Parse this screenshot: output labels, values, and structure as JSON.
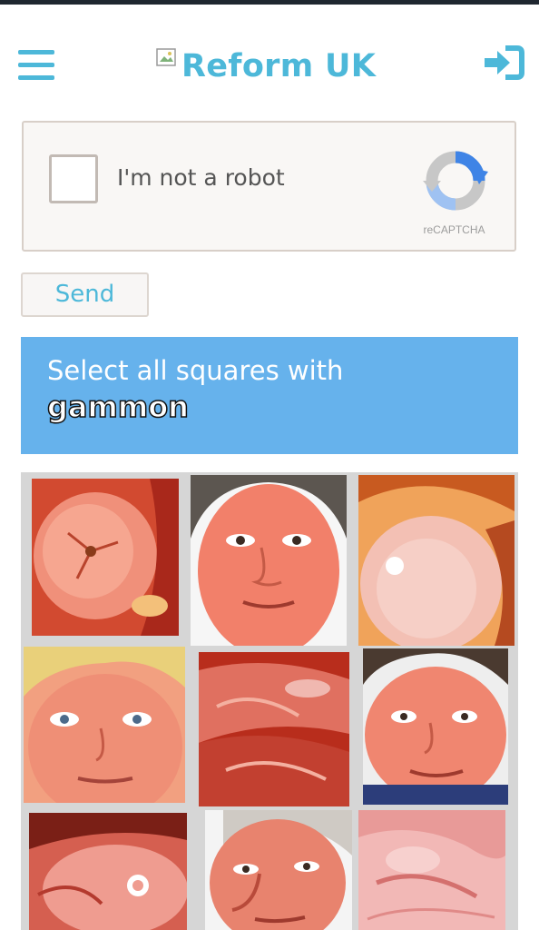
{
  "header": {
    "logo_text": "Reform UK",
    "menu_icon": "hamburger-menu-icon",
    "signin_icon": "sign-in-icon",
    "accent_color": "#4db8d9"
  },
  "recaptcha": {
    "checkbox_label": "I'm not a robot",
    "brand": "reCAPTCHA",
    "checked": false
  },
  "send_button": {
    "label": "Send"
  },
  "challenge": {
    "instruction": "Select all squares with",
    "target": "gammon",
    "header_color": "#66b2ec"
  },
  "tiles": [
    {
      "content": "gammon-meat"
    },
    {
      "content": "face"
    },
    {
      "content": "gammon-meat"
    },
    {
      "content": "face"
    },
    {
      "content": "gammon-meat"
    },
    {
      "content": "face"
    },
    {
      "content": "gammon-meat"
    },
    {
      "content": "face"
    },
    {
      "content": "gammon-meat"
    }
  ]
}
